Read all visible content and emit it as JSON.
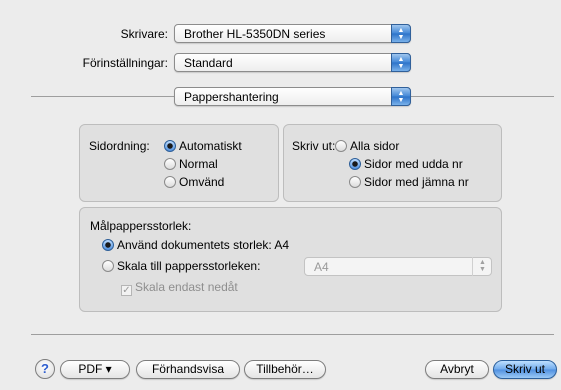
{
  "printer": {
    "label": "Skrivare:",
    "value": "Brother HL-5350DN series"
  },
  "presets": {
    "label": "Förinställningar:",
    "value": "Standard"
  },
  "panel": {
    "value": "Pappershantering"
  },
  "page_order": {
    "label": "Sidordning:",
    "options": [
      {
        "label": "Automatiskt",
        "selected": true
      },
      {
        "label": "Normal",
        "selected": false
      },
      {
        "label": "Omvänd",
        "selected": false
      }
    ]
  },
  "print_pages": {
    "label": "Skriv ut:",
    "options": [
      {
        "label": "Alla sidor",
        "selected": false
      },
      {
        "label": "Sidor med udda nr",
        "selected": true
      },
      {
        "label": "Sidor med jämna nr",
        "selected": false
      }
    ]
  },
  "destination": {
    "title": "Målpappersstorlek:",
    "use_document_size": {
      "label": "Använd dokumentets storlek: A4",
      "selected": true
    },
    "scale_to_paper": {
      "label": "Skala till pappersstorleken:",
      "selected": false,
      "value": "A4"
    },
    "scale_down_only": {
      "label": "Skala endast nedåt",
      "checked": true,
      "enabled": false
    }
  },
  "footer": {
    "help": "?",
    "pdf": "PDF ▾",
    "preview": "Förhandsvisa",
    "supplies": "Tillbehör…",
    "cancel": "Avbryt",
    "print": "Skriv ut"
  },
  "colors": {
    "accent": "#3f85d6",
    "background": "#ececec",
    "group": "#e0e0e0"
  }
}
